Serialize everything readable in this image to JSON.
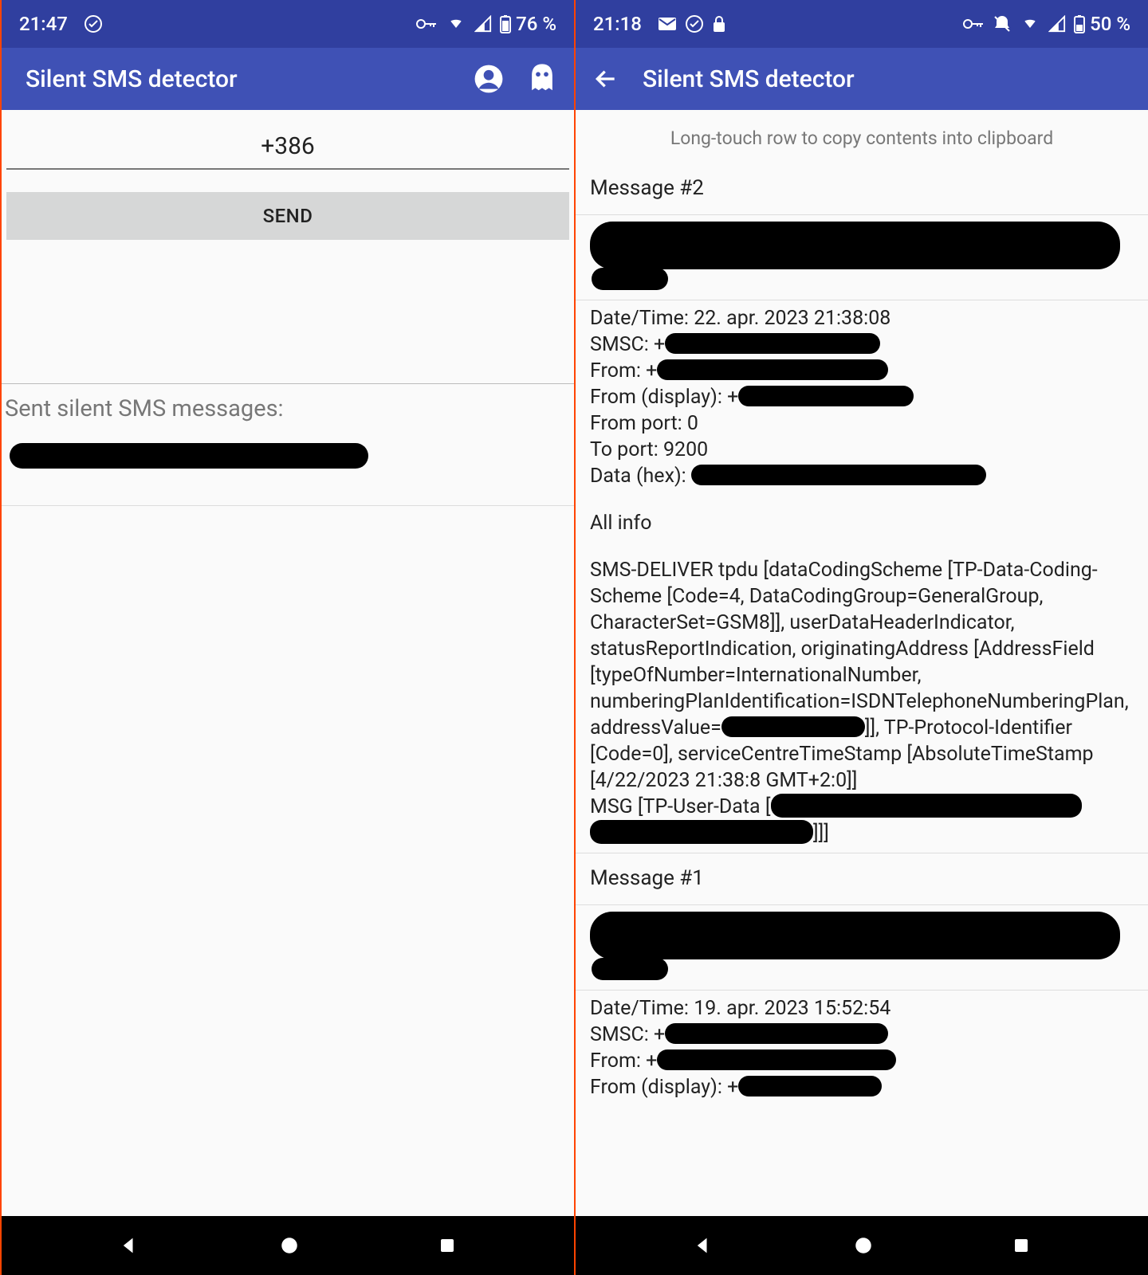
{
  "left": {
    "status": {
      "time": "21:47",
      "battery": "76 %"
    },
    "app_title": "Silent SMS detector",
    "phone_input": "+386",
    "send_label": "SEND",
    "sent_label": "Sent silent SMS messages:"
  },
  "right": {
    "status": {
      "time": "21:18",
      "battery": "50 %"
    },
    "app_title": "Silent SMS detector",
    "hint": "Long-touch row to copy contents into clipboard",
    "msg2": {
      "header": "Message #2",
      "datetime_label": "Date/Time: ",
      "datetime": "22. apr. 2023 21:38:08",
      "smsc_label": "SMSC: +",
      "from_label": "From: +",
      "from_display_label": "From (display): +",
      "from_port": "From port: 0",
      "to_port": "To port: 9200",
      "data_hex_label": "Data (hex): ",
      "all_info": "All info",
      "tpdu1": "SMS-DELIVER tpdu [dataCodingScheme [TP-Data-Coding-Scheme [Code=4, DataCodingGroup=GeneralGroup, CharacterSet=GSM8]], userDataHeaderIndicator, statusReportIndication, originatingAddress [AddressField [typeOfNumber=InternationalNumber, numberingPlanIdentification=ISDNTelephoneNumberingPlan, addressValue=",
      "tpdu2": "]], TP-Protocol-Identifier [Code=0], serviceCentreTimeStamp [AbsoluteTimeStamp [4/22/2023 21:38:8 GMT+2:0]]",
      "msg_label": "MSG [TP-User-Data [",
      "msg_tail": "]]]"
    },
    "msg1": {
      "header": "Message #1",
      "datetime_label": "Date/Time: ",
      "datetime": "19. apr. 2023 15:52:54",
      "smsc_label": "SMSC: +",
      "from_label": "From: +",
      "from_display_label": "From (display): +"
    }
  }
}
